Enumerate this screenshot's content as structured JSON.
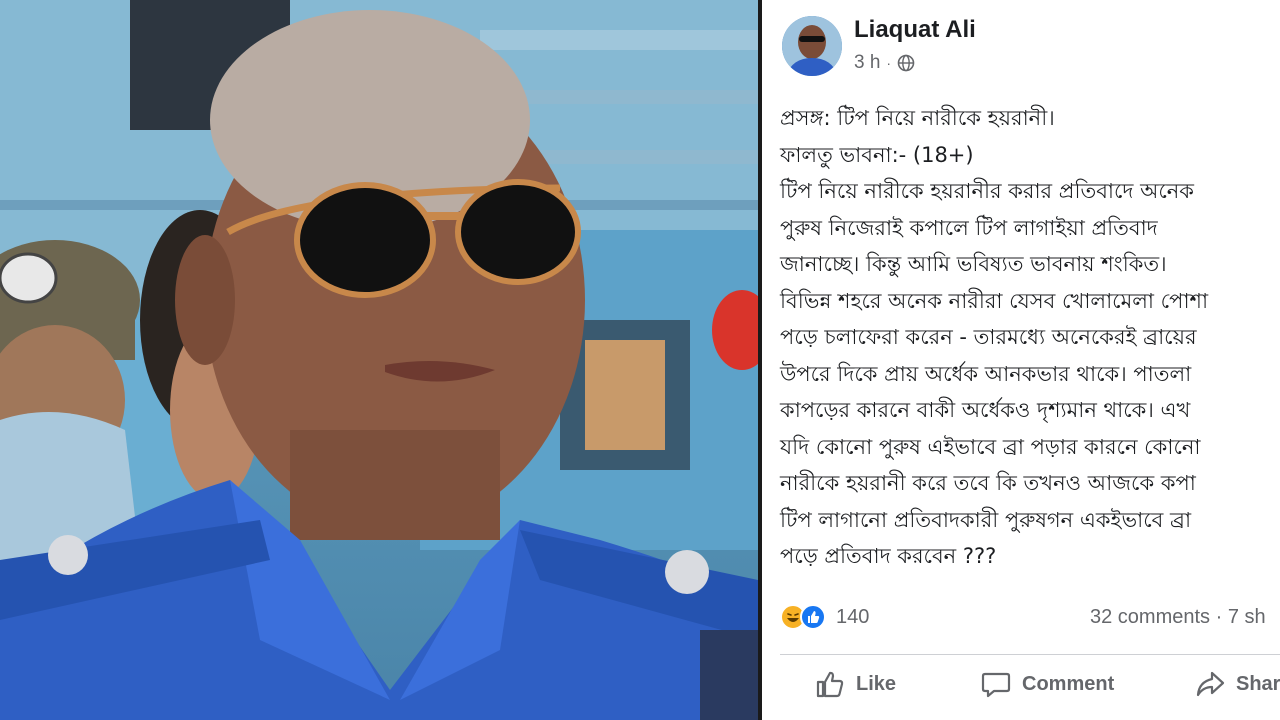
{
  "post": {
    "author": "Liaquat Ali",
    "time": "3 h",
    "dot": "·",
    "lines": [
      "প্রসঙ্গ: টিপ নিয়ে নারীকে হয়রানী।",
      "ফালতু ভাবনা:-   (18+)",
      " টিপ নিয়ে নারীকে হয়রানীর করার প্রতিবাদে অনেক",
      "পুরুষ নিজেরাই কপালে টিপ লাগাইয়া প্রতিবাদ",
      "জানাচ্ছে। কিন্তু আমি ভবিষ্যত ভাবনায় শংকিত।",
      "বিভিন্ন শহরে অনেক নারীরা যেসব খোলামেলা পোশা",
      "পড়ে চলাফেরা করেন - তারমধ্যে অনেকেরই ব্রায়ের",
      "উপরে দিকে প্রায় অর্ধেক আনকভার থাকে। পাতলা",
      "কাপড়ের কারনে বাকী অর্ধেকও দৃশ্যমান থাকে। এখ",
      "যদি কোনো পুরুষ এইভাবে ব্রা পড়ার কারনে কোনো",
      "নারীকে হয়রানী করে তবে কি তখনও আজকে কপা",
      "টিপ লাগানো প্রতিবাদকারী পুরুষগন একইভাবে ব্রা",
      "পড়ে প্রতিবাদ করবেন ???"
    ],
    "reaction_count": "140",
    "comments_shares": "32 comments · 7 sh",
    "actions": {
      "like": "Like",
      "comment": "Comment",
      "share": "Shar"
    }
  },
  "colors": {
    "uniform_blue": "#2f5fc4",
    "facebook_blue": "#1877f2",
    "meta_gray": "#65676b"
  }
}
